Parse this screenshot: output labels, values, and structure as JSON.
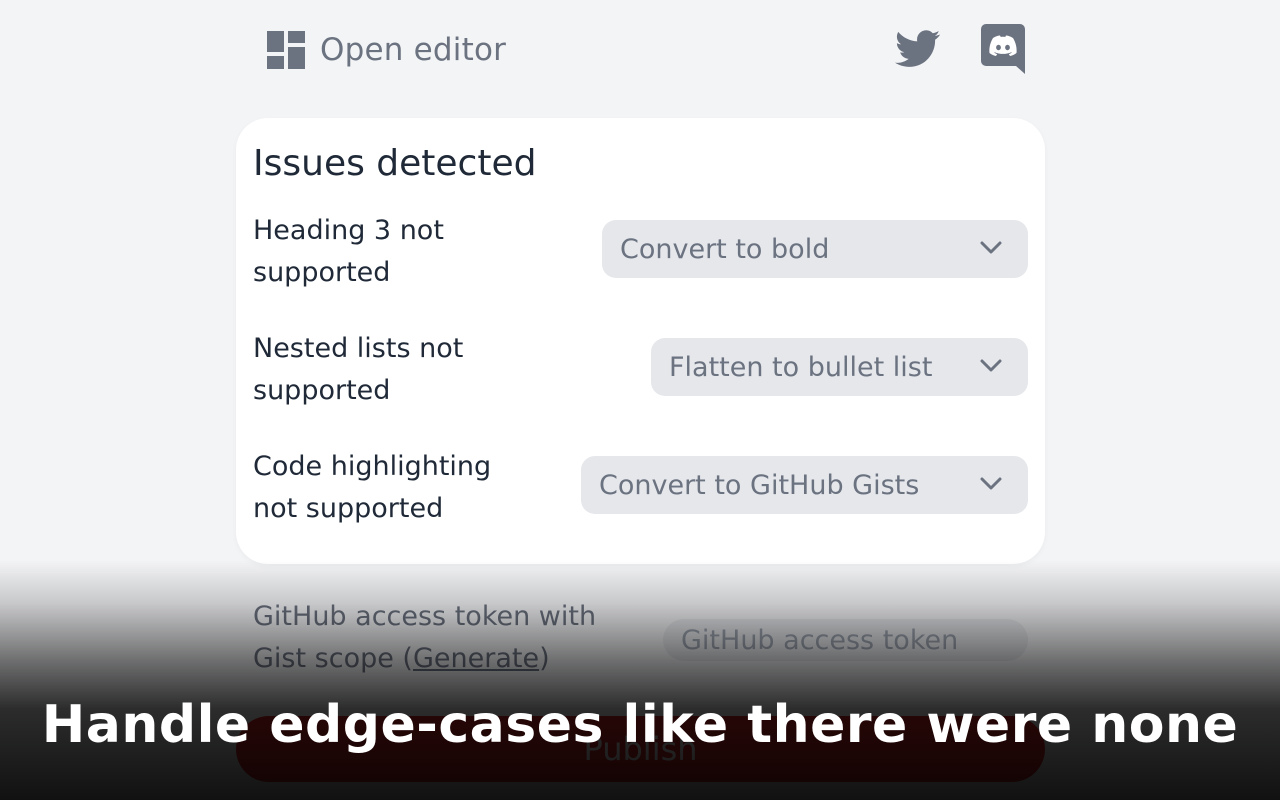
{
  "header": {
    "open_editor_label": "Open editor",
    "open_editor_icon": "dashboard-layout-icon",
    "twitter_icon": "twitter-icon",
    "discord_icon": "discord-icon"
  },
  "issues": {
    "title": "Issues detected",
    "items": [
      {
        "label": "Heading 3 not supported",
        "selected": "Convert to bold"
      },
      {
        "label": "Nested lists not supported",
        "selected": "Flatten to bullet list"
      },
      {
        "label": "Code highlighting not supported",
        "selected": "Convert to GitHub Gists"
      }
    ]
  },
  "token": {
    "label_prefix": "GitHub access token with Gist scope (",
    "generate_link": "Generate",
    "label_suffix": ")",
    "placeholder": "GitHub access token"
  },
  "publish": {
    "label": "Publish"
  },
  "caption": "Handle edge-cases like there were none",
  "colors": {
    "page_bg": "#f3f4f6",
    "card_bg": "#ffffff",
    "select_bg": "#e5e7eb",
    "muted_text": "#6b7280",
    "dark_text": "#1f2937",
    "publish_bg": "#dc2626"
  }
}
